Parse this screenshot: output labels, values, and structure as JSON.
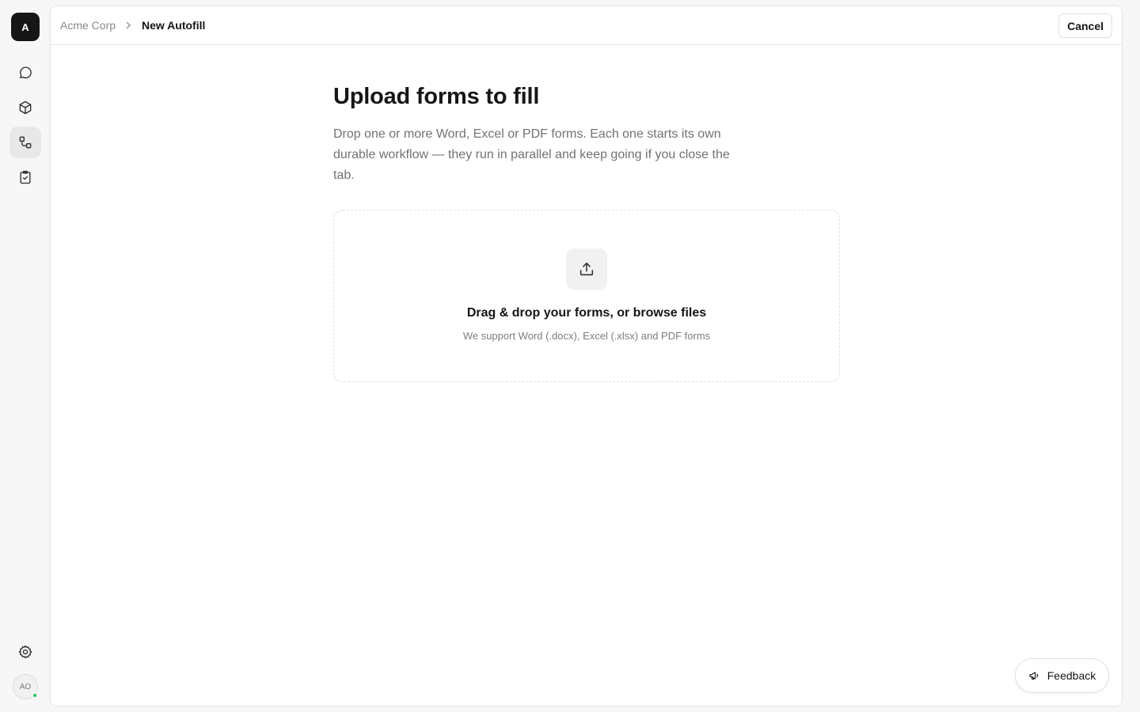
{
  "sidebar": {
    "logo_letter": "A",
    "items": [
      {
        "icon": "chat-icon",
        "active": false
      },
      {
        "icon": "cube-icon",
        "active": false
      },
      {
        "icon": "workflow-icon",
        "active": true
      },
      {
        "icon": "clipboard-check-icon",
        "active": false
      }
    ],
    "settings_icon": "gear-icon",
    "avatar_initials": "AO",
    "status_color": "#22c55e"
  },
  "breadcrumb": {
    "root": "Acme Corp",
    "current": "New Autofill"
  },
  "header": {
    "cancel_label": "Cancel"
  },
  "main": {
    "title": "Upload forms to fill",
    "description": "Drop one or more Word, Excel or PDF forms. Each one starts its own durable workflow — they run in parallel and keep going if you close the tab.",
    "dropzone": {
      "icon": "upload-icon",
      "title": "Drag & drop your forms, or browse files",
      "subtitle": "We support Word (.docx), Excel (.xlsx) and PDF forms"
    }
  },
  "feedback": {
    "icon": "megaphone-icon",
    "label": "Feedback"
  }
}
